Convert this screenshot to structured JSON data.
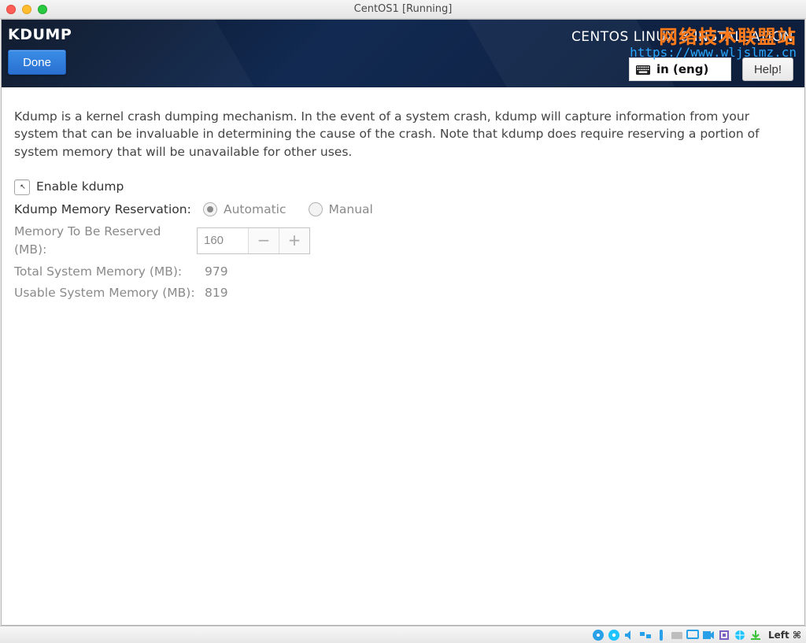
{
  "vm": {
    "title": "CentOS1 [Running]"
  },
  "watermark": {
    "cn": "网络技术联盟站",
    "url": "https://www.wljslmz.cn"
  },
  "header": {
    "title": "KDUMP",
    "done_label": "Done",
    "subtitle": "CENTOS LINUX 8 INSTALLATION",
    "lang_label": "in (eng)",
    "help_label": "Help!"
  },
  "content": {
    "description": "Kdump is a kernel crash dumping mechanism. In the event of a system crash, kdump will capture information from your system that can be invaluable in determining the cause of the crash. Note that kdump does require reserving a portion of system memory that will be unavailable for other uses.",
    "enable_label": "Enable kdump",
    "enable_checked": false,
    "reservation_label": "Kdump Memory Reservation:",
    "radio_automatic": "Automatic",
    "radio_manual": "Manual",
    "reservation_mode": "automatic",
    "memory_to_reserve_label": "Memory To Be Reserved (MB):",
    "memory_to_reserve_value": "160",
    "total_label": "Total System Memory (MB):",
    "total_value": "979",
    "usable_label": "Usable System Memory (MB):",
    "usable_value": "819"
  },
  "statusbar": {
    "host_key": "Left ⌘"
  }
}
